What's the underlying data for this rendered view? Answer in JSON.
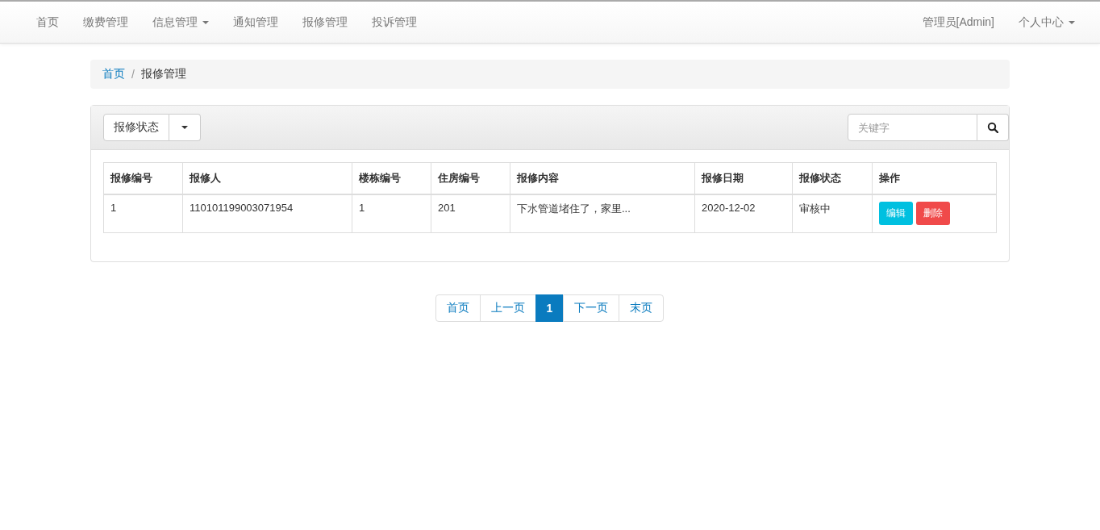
{
  "navbar": {
    "left_items": [
      {
        "label": "首页",
        "caret": false
      },
      {
        "label": "缴费管理",
        "caret": false
      },
      {
        "label": "信息管理",
        "caret": true
      },
      {
        "label": "通知管理",
        "caret": false
      },
      {
        "label": "报修管理",
        "caret": false
      },
      {
        "label": "投诉管理",
        "caret": false
      }
    ],
    "right_items": [
      {
        "label": "管理员[Admin]",
        "caret": false
      },
      {
        "label": "个人中心",
        "caret": true
      }
    ]
  },
  "breadcrumb_separator": "/",
  "breadcrumb": [
    {
      "label": "首页",
      "selected": false
    },
    {
      "label": "报修管理",
      "selected": true
    }
  ],
  "toolbar": {
    "filter_button": "报修状态",
    "search": {
      "placeholder": "关键字"
    }
  },
  "table": {
    "columns": [
      "报修编号",
      "报修人",
      "楼栋编号",
      "住房编号",
      "报修内容",
      "报修日期",
      "报修状态",
      "操作"
    ],
    "rows": [
      {
        "cells": [
          "1",
          "110101199003071954",
          "1",
          "201",
          "下水管道堵住了，家里...",
          "2020-12-02",
          "审核中"
        ],
        "actions": [
          {
            "label": "编辑",
            "kind": "edit"
          },
          {
            "label": "删除",
            "kind": "delete"
          }
        ]
      }
    ]
  },
  "pagination": [
    {
      "label": "首页",
      "selected": false
    },
    {
      "label": "上一页",
      "selected": false
    },
    {
      "label": "1",
      "selected": true
    },
    {
      "label": "下一页",
      "selected": false
    },
    {
      "label": "末页",
      "selected": false
    }
  ]
}
